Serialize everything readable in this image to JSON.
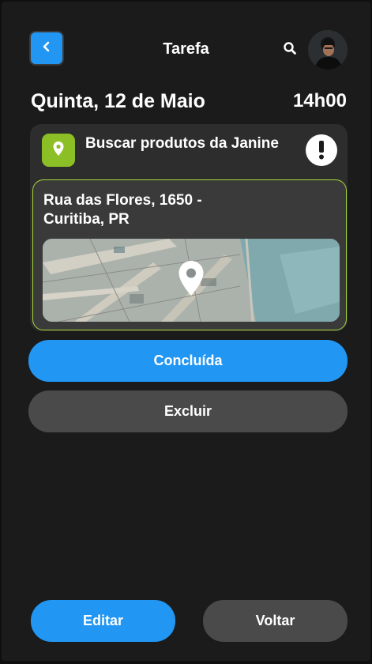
{
  "header": {
    "title": "Tarefa",
    "back_icon": "chevron-left-icon",
    "search_icon": "search-icon"
  },
  "task": {
    "date": "Quinta, 12 de Maio",
    "time": "14h00",
    "title": "Buscar produtos da Janine",
    "category_icon": "location-pin-icon",
    "alert_icon": "exclamation-icon",
    "address": "Rua das Flores, 1650 - Curitiba, PR"
  },
  "actions": {
    "done_label": "Concluída",
    "delete_label": "Excluir",
    "edit_label": "Editar",
    "back_label": "Voltar"
  },
  "colors": {
    "background": "#1b1b1b",
    "primary": "#2196f3",
    "secondary": "#4a4a4a",
    "accent_green": "#8cbf26",
    "card": "#2d2d2d"
  }
}
